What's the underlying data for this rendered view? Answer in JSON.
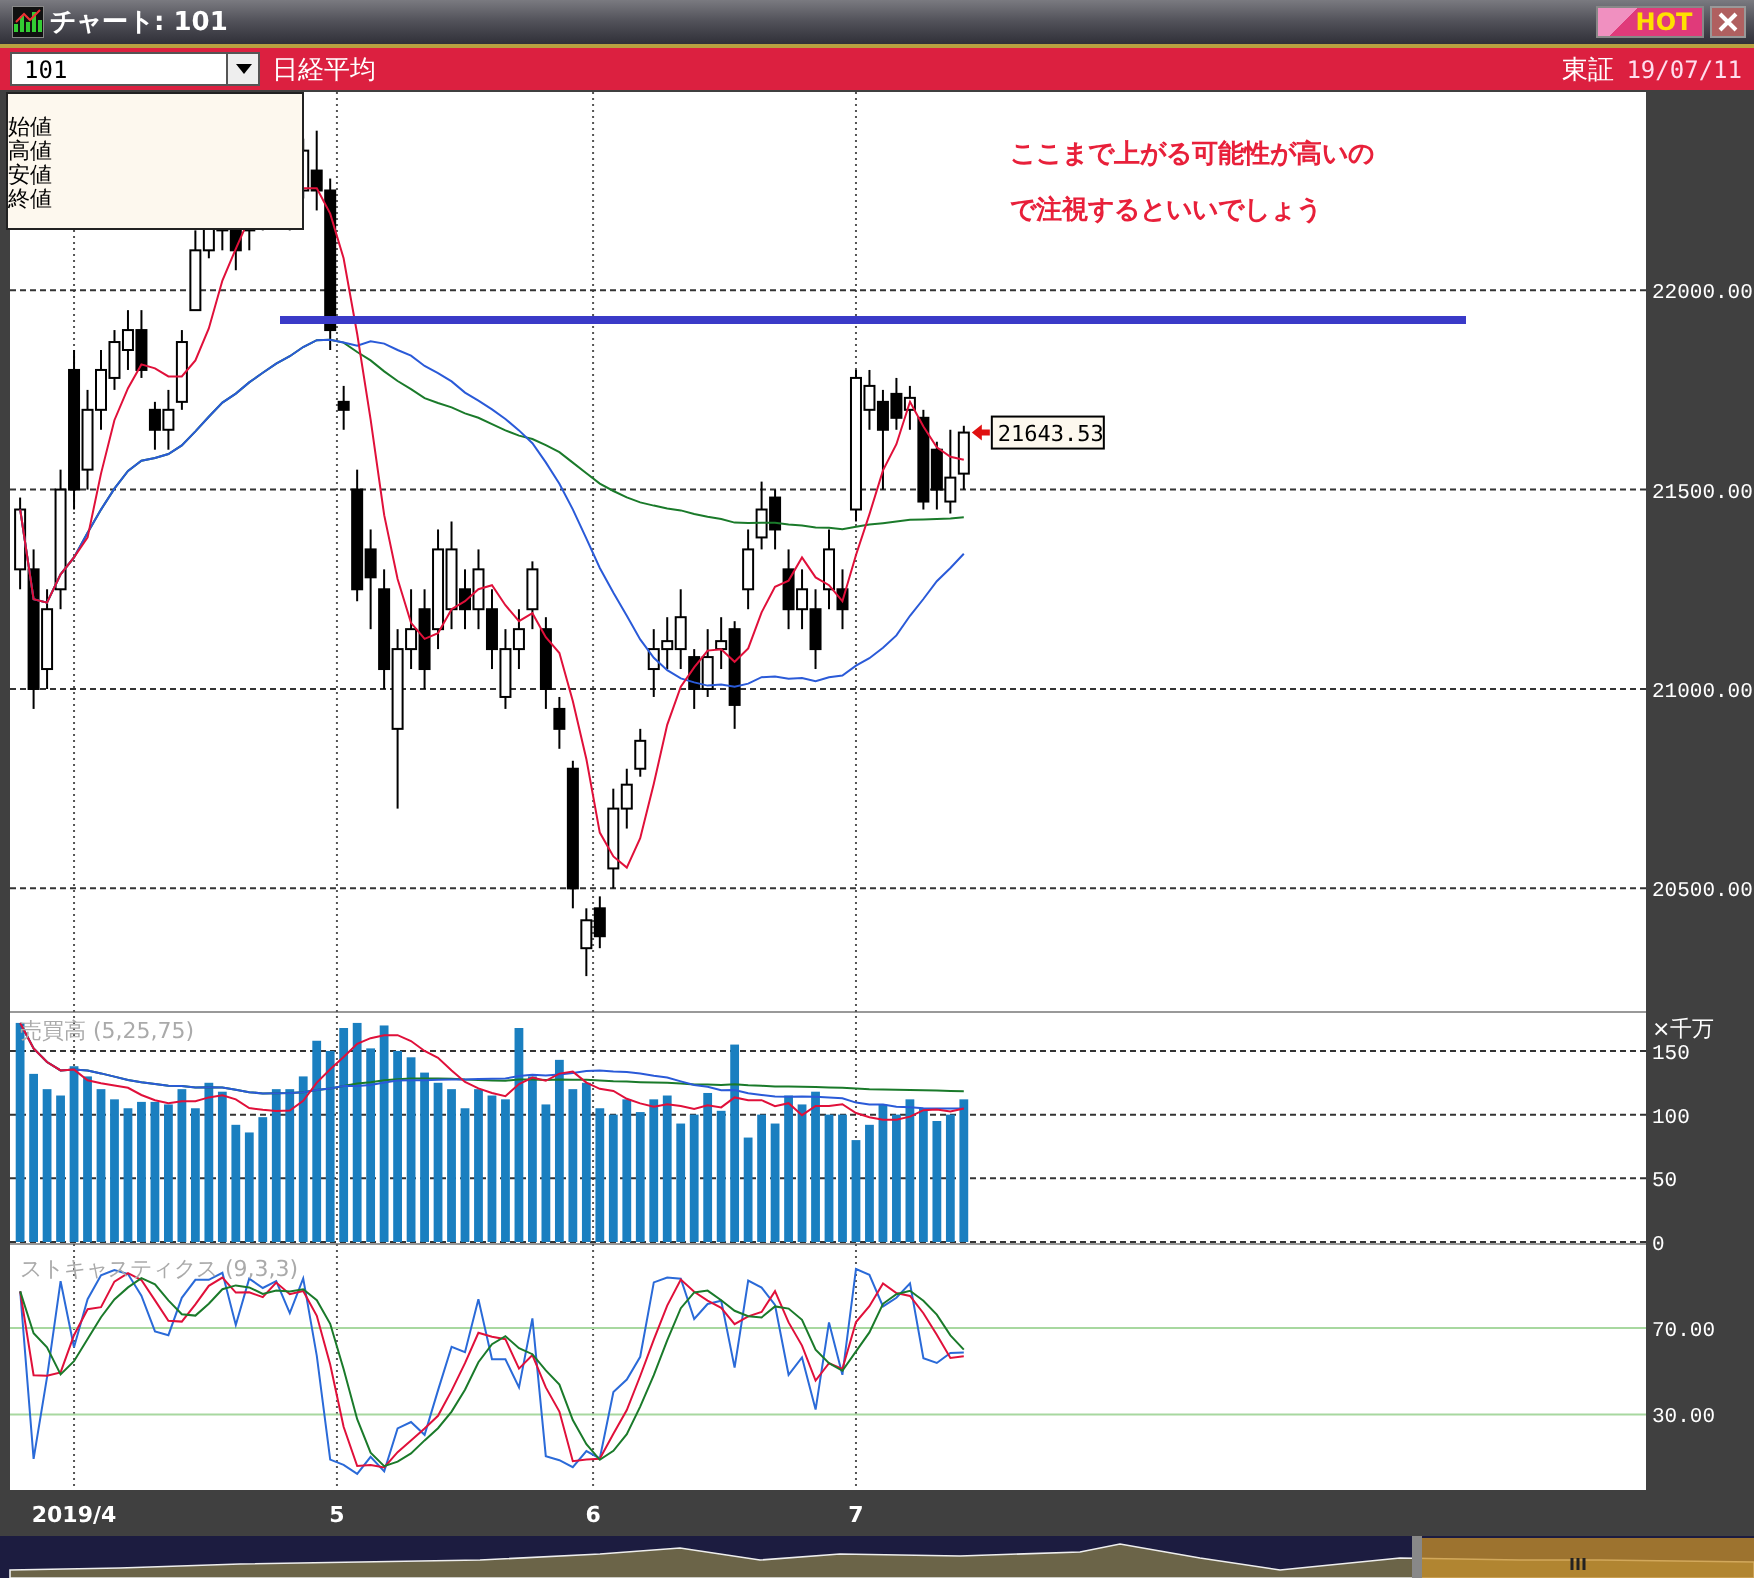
{
  "window": {
    "title": "チャート: 101",
    "hot_button": "HOT"
  },
  "toolbar": {
    "symbol_field": {
      "value": "101"
    },
    "symbol_name": "日経平均",
    "exchange": "東証",
    "date": "19/07/11"
  },
  "legend": {
    "items": [
      "始値",
      "高値",
      "安値",
      "終値"
    ]
  },
  "price_panel": {
    "annotation": "ここまで上がる可能性が高いので注視するといいでしょう",
    "last_price_label": "21643.53",
    "y_axis_labels": [
      "22000.00",
      "21500.00",
      "21000.00",
      "20500.00"
    ]
  },
  "volume_panel": {
    "title": "売買高 (5,25,75)",
    "unit": "×千万",
    "y_axis_labels": [
      "150",
      "100",
      "50",
      "0"
    ]
  },
  "stochastic_panel": {
    "title": "ストキャスティクス (9,3,3)",
    "y_axis_labels": [
      "70.00",
      "30.00"
    ]
  },
  "time_axis_labels": [
    "2019/4",
    "5",
    "6",
    "7"
  ]
}
